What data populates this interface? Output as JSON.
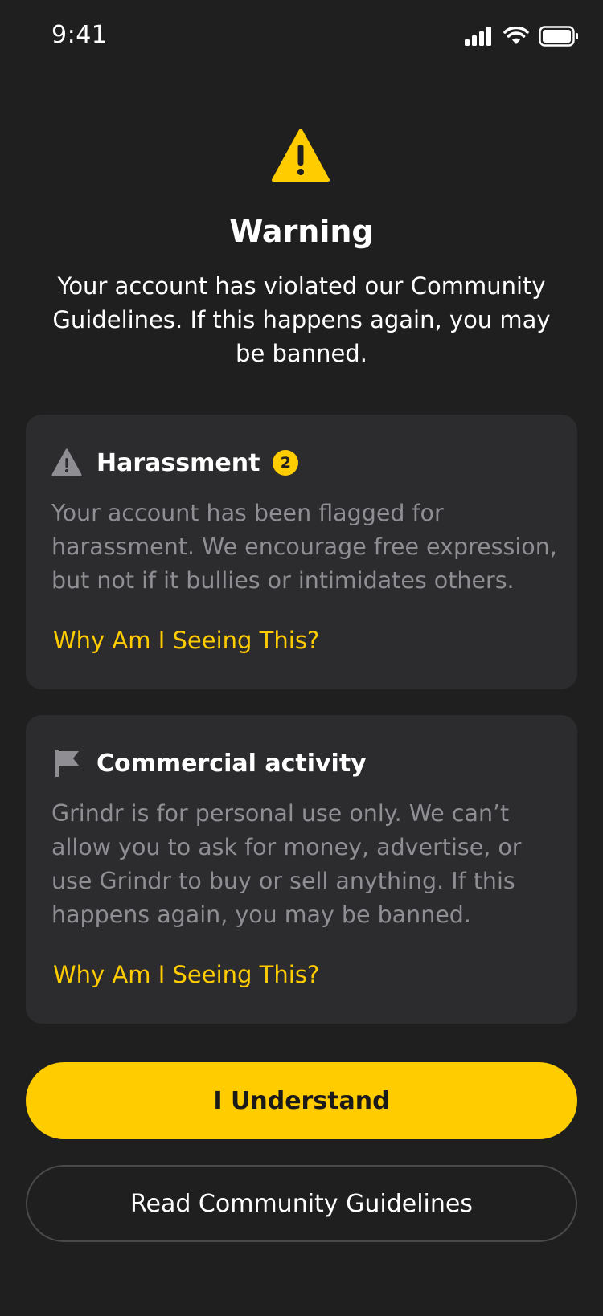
{
  "status_bar": {
    "time": "9:41",
    "icons": [
      "cellular-signal-icon",
      "wifi-icon",
      "battery-icon"
    ]
  },
  "header": {
    "icon": "warning-triangle-icon",
    "title": "Warning",
    "subtitle": "Your account has violated our Community Guidelines. If this happens again, you may be banned."
  },
  "violations": [
    {
      "icon": "warning-triangle-icon",
      "title": "Harassment",
      "badge": "2",
      "body": "Your account has been flagged for harassment. We encourage free expression, but not if it bullies or intimidates others.",
      "link": "Why Am I Seeing This?"
    },
    {
      "icon": "flag-icon",
      "title": "Commercial activity",
      "body": "Grindr is for personal use only. We can’t allow you to ask for money, advertise, or use Grindr to buy or sell anything. If this happens again, you may be banned.",
      "link": "Why Am I Seeing This?"
    }
  ],
  "actions": {
    "primary_label": "I Understand",
    "secondary_label": "Read Community Guidelines"
  },
  "colors": {
    "background": "#1f1f1f",
    "card": "#2c2c2e",
    "accent": "#ffcc00",
    "muted_text": "#8e8e93"
  }
}
